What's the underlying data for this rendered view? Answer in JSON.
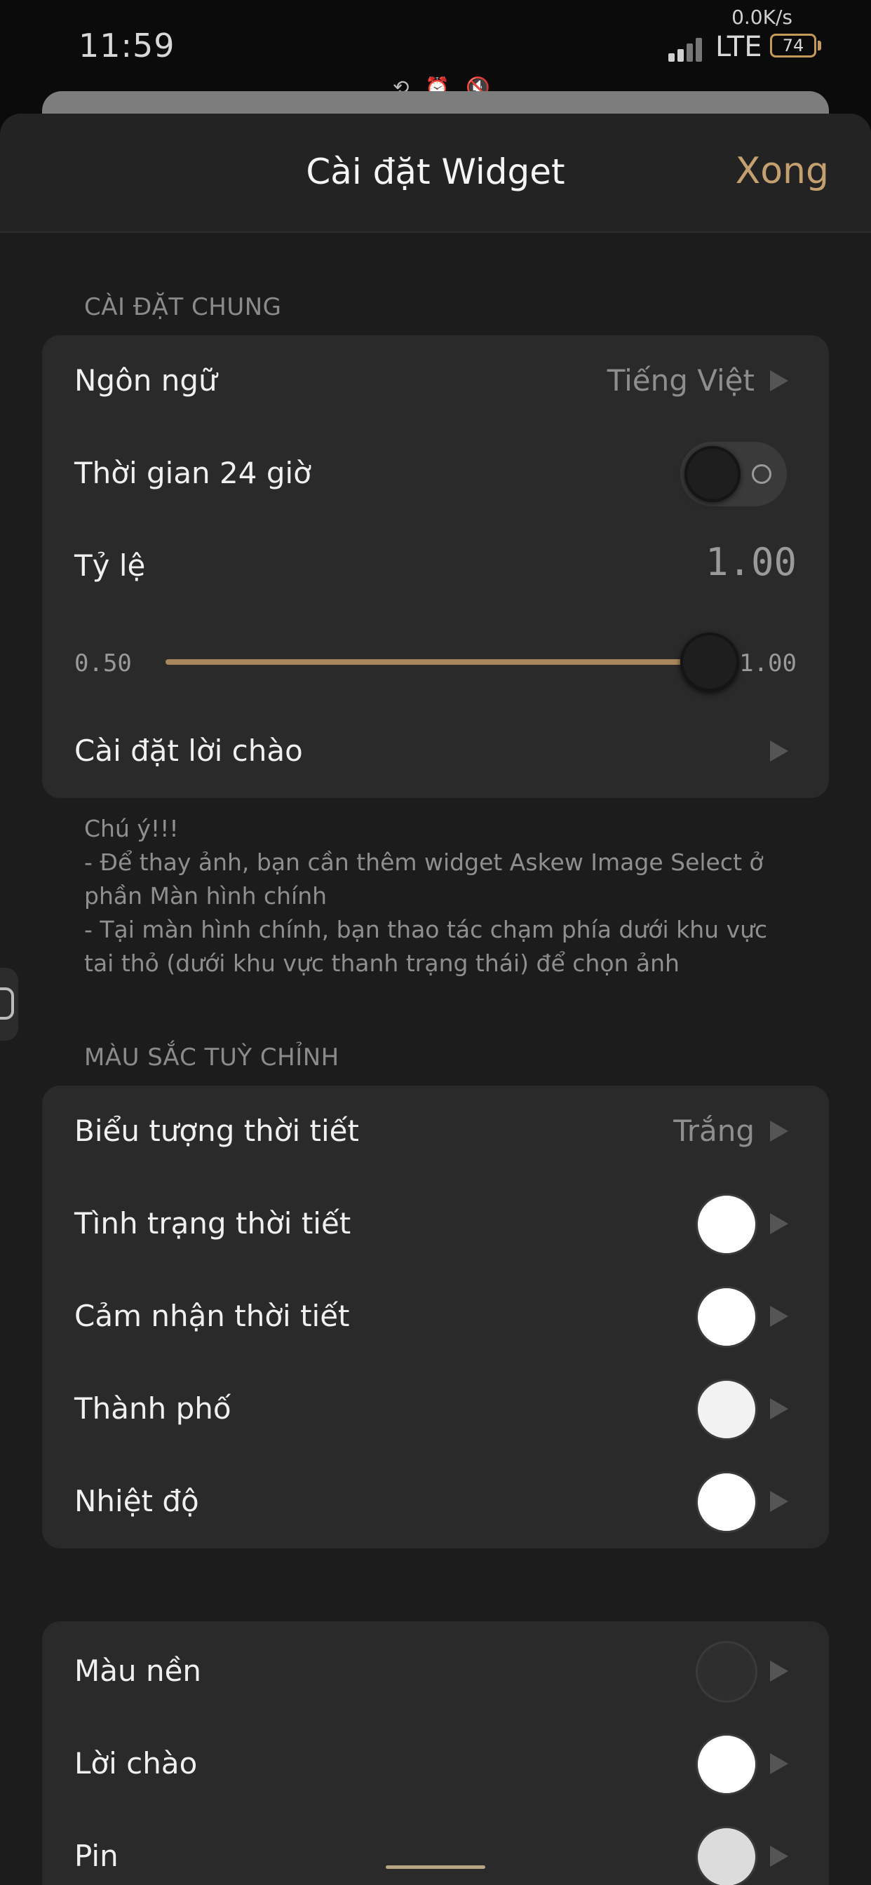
{
  "status_bar": {
    "time": "11:59",
    "net_speed": "0.0K/s",
    "network": "LTE",
    "battery": "74",
    "icons": [
      "lock-rotation-icon",
      "alarm-icon",
      "mute-icon"
    ]
  },
  "header": {
    "title": "Cài đặt Widget",
    "done_label": "Xong"
  },
  "general": {
    "section_label": "CÀI ĐẶT CHUNG",
    "language_label": "Ngôn ngữ",
    "language_value": "Tiếng Việt",
    "time24_label": "Thời gian 24 giờ",
    "time24_enabled": false,
    "scale_label": "Tỷ lệ",
    "scale_value": "1.00",
    "slider_min": "0.50",
    "slider_max": "1.00",
    "slider_position": 1.0,
    "greeting_label": "Cài đặt lời chào"
  },
  "note": {
    "lines": [
      "Chú ý!!!",
      "- Để thay ảnh, bạn cần thêm widget Askew Image Select ở phần Màn hình chính",
      "- Tại màn hình chính, bạn thao tác chạm phía dưới khu vực tai thỏ (dưới khu vực thanh trạng thái) để chọn ảnh"
    ]
  },
  "colors_section": {
    "section_label": "MÀU SẮC TUỲ CHỈNH",
    "weather_icon_label": "Biểu tượng thời tiết",
    "weather_icon_value": "Trắng",
    "items": [
      {
        "label": "Tình trạng thời tiết",
        "color": "#ffffff"
      },
      {
        "label": "Cảm nhận thời tiết",
        "color": "#ffffff"
      },
      {
        "label": "Thành phố",
        "color": "#f2f2f2"
      },
      {
        "label": "Nhiệt độ",
        "color": "#ffffff"
      }
    ]
  },
  "colors_section_2": {
    "items": [
      {
        "label": "Màu nền",
        "color": "#2e2e2e"
      },
      {
        "label": "Lời chào",
        "color": "#ffffff"
      },
      {
        "label": "Pin",
        "color": "#dcdcdc"
      }
    ]
  },
  "theme": {
    "accent": "#c4a070",
    "slider_fill": "#a8875a"
  }
}
